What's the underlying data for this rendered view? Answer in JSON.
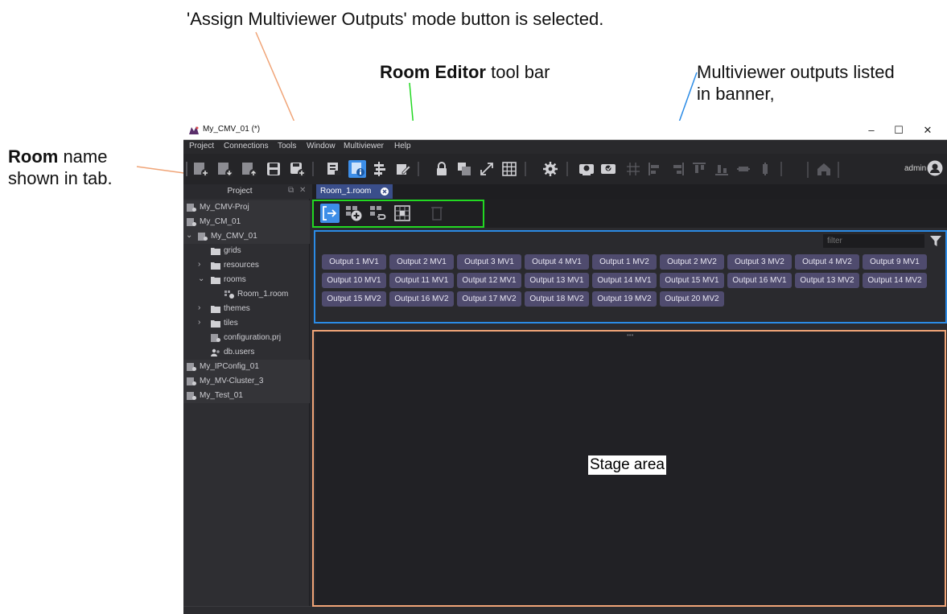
{
  "annotations": {
    "assign_mode": "'Assign Multiviewer Outputs' mode button is selected.",
    "toolbar_bold": "Room Editor",
    "toolbar_rest": " tool bar",
    "outputs_line1": "Multiviewer outputs listed",
    "outputs_line2": "in banner,",
    "room_bold": "Room",
    "room_rest1": " name",
    "room_line2": "shown in tab."
  },
  "window": {
    "title": "My_CMV_01 (*)",
    "minimize": "–",
    "maximize": "☐",
    "close": "✕"
  },
  "menu": [
    "Project",
    "Connections",
    "Tools",
    "Window",
    "Multiviewer",
    "Help"
  ],
  "toolbar": {
    "icons": [
      "new-project-icon",
      "open-project-icon",
      "import-project-icon",
      "save-icon",
      "save-as-icon",
      "project-info-icon",
      "room-icon",
      "align-icon",
      "edit-icon",
      "lock-icon",
      "layer-icon",
      "fullscreen-icon",
      "grid-icon",
      "settings-icon",
      "deploy-icon",
      "deploy-all-icon",
      "snap-grid-icon",
      "align-left-icon",
      "align-right-icon",
      "align-top-icon",
      "align-bottom-icon",
      "center-horizontal-icon",
      "center-vertical-icon",
      "home-icon"
    ],
    "user": "admin"
  },
  "project_panel": {
    "title": "Project",
    "items": [
      {
        "label": "My_CMV-Proj"
      },
      {
        "label": "My_CM_01"
      },
      {
        "label": "My_CMV_01",
        "expanded": true
      },
      {
        "label": "grids"
      },
      {
        "label": "resources",
        "expanded": false
      },
      {
        "label": "rooms",
        "expanded": true
      },
      {
        "label": "Room_1.room"
      },
      {
        "label": "themes",
        "expanded": false
      },
      {
        "label": "tiles",
        "expanded": false
      },
      {
        "label": "configuration.prj"
      },
      {
        "label": "db.users"
      },
      {
        "label": "My_IPConfig_01"
      },
      {
        "label": "My_MV-Cluster_3"
      },
      {
        "label": "My_Test_01"
      }
    ]
  },
  "editor": {
    "tab_label": "Room_1.room",
    "toolbar_buttons": [
      "assign-multiviewer-outputs-icon",
      "add-tile-icon",
      "link-tiles-icon",
      "grid-select-icon",
      "delete-icon"
    ],
    "filter_placeholder": "filter",
    "outputs": [
      "Output 1 MV1",
      "Output 2 MV1",
      "Output 3 MV1",
      "Output 4 MV1",
      "Output 1 MV2",
      "Output 2 MV2",
      "Output 3 MV2",
      "Output 4 MV2",
      "Output 9 MV1",
      "Output 10 MV1",
      "Output 11 MV1",
      "Output 12 MV1",
      "Output 13 MV1",
      "Output 14 MV1",
      "Output 15 MV1",
      "Output 16 MV1",
      "Output 13 MV2",
      "Output 14 MV2",
      "Output 15 MV2",
      "Output 16 MV2",
      "Output 17 MV2",
      "Output 18 MV2",
      "Output 19 MV2",
      "Output 20 MV2"
    ],
    "stage_label": "Stage area"
  },
  "colors": {
    "accent": "#3d8ee8",
    "toolbar_highlight": "#22d822",
    "banner_highlight": "#2b8be6",
    "stage_highlight": "#f0a477",
    "output_button": "#4f4b6e"
  }
}
